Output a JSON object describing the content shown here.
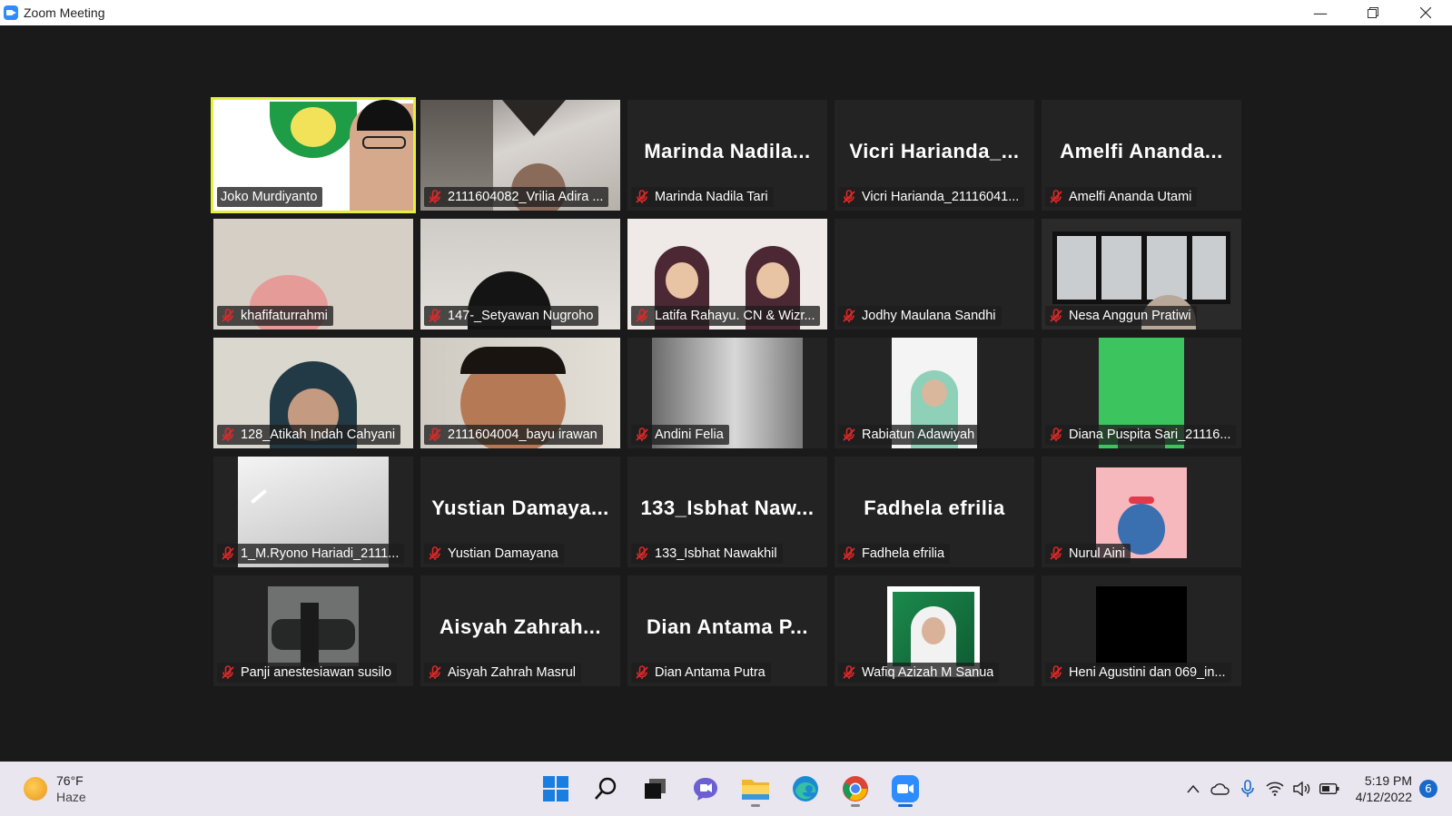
{
  "window": {
    "title": "Zoom Meeting"
  },
  "participants": [
    {
      "name": "Joko Murdiyanto",
      "big_name": "",
      "video": true,
      "active": true,
      "muted": false
    },
    {
      "name": "2111604082_Vrilia Adira ...",
      "big_name": "",
      "video": true,
      "muted": true
    },
    {
      "name": "Marinda Nadila Tari",
      "big_name": "Marinda  Nadila...",
      "video": false,
      "muted": true
    },
    {
      "name": "Vicri Harianda_21116041...",
      "big_name": "Vicri  Harianda_...",
      "video": false,
      "muted": true
    },
    {
      "name": "Amelfi Ananda Utami",
      "big_name": "Amelfi  Ananda...",
      "video": false,
      "muted": true
    },
    {
      "name": "khafifaturrahmi",
      "big_name": "",
      "video": true,
      "muted": true
    },
    {
      "name": "147-_Setyawan Nugroho",
      "big_name": "",
      "video": true,
      "muted": true
    },
    {
      "name": "Latifa Rahayu. CN & Wizr...",
      "big_name": "",
      "video": true,
      "muted": true
    },
    {
      "name": "Jodhy Maulana Sandhi",
      "big_name": "",
      "video": false,
      "muted": true
    },
    {
      "name": "Nesa Anggun Pratiwi",
      "big_name": "",
      "video": true,
      "muted": true
    },
    {
      "name": "128_Atikah Indah Cahyani",
      "big_name": "",
      "video": true,
      "muted": true
    },
    {
      "name": "2111604004_bayu irawan",
      "big_name": "",
      "video": true,
      "muted": true
    },
    {
      "name": "Andini Felia",
      "big_name": "",
      "video": true,
      "muted": true
    },
    {
      "name": "Rabiatun Adawiyah",
      "big_name": "",
      "video": true,
      "muted": true
    },
    {
      "name": "Diana Puspita Sari_21116...",
      "big_name": "",
      "video": true,
      "muted": true
    },
    {
      "name": "1_M.Ryono Hariadi_2111...",
      "big_name": "",
      "video": true,
      "muted": true
    },
    {
      "name": "Yustian Damayana",
      "big_name": "Yustian  Damaya...",
      "video": false,
      "muted": true
    },
    {
      "name": "133_Isbhat Nawakhil",
      "big_name": "133_Isbhat  Naw...",
      "video": false,
      "muted": true
    },
    {
      "name": "Fadhela efrilia",
      "big_name": "Fadhela efrilia",
      "video": false,
      "muted": true
    },
    {
      "name": "Nurul Aini",
      "big_name": "",
      "video": true,
      "muted": true
    },
    {
      "name": "Panji anestesiawan susilo",
      "big_name": "",
      "video": true,
      "muted": true
    },
    {
      "name": "Aisyah Zahrah Masrul",
      "big_name": "Aisyah  Zahrah...",
      "video": false,
      "muted": true
    },
    {
      "name": "Dian Antama Putra",
      "big_name": "Dian Antama  P...",
      "video": false,
      "muted": true
    },
    {
      "name": "Wafiq Azizah M Sanua",
      "big_name": "",
      "video": true,
      "muted": true
    },
    {
      "name": "Heni Agustini dan 069_in...",
      "big_name": "",
      "video": true,
      "muted": true
    }
  ],
  "taskbar": {
    "weather_temp": "76°F",
    "weather_desc": "Haze",
    "time": "5:19 PM",
    "date": "4/12/2022",
    "notifications": "6",
    "apps": [
      "start-icon",
      "search-icon",
      "task-view-icon",
      "teams-chat-icon",
      "file-explorer-icon",
      "edge-icon",
      "chrome-icon",
      "zoom-icon"
    ]
  },
  "colors": {
    "active_speaker": "#e6ef3c",
    "mute_red": "#e02828",
    "background": "#1a1a1a",
    "taskbar": "#eae6ef"
  }
}
